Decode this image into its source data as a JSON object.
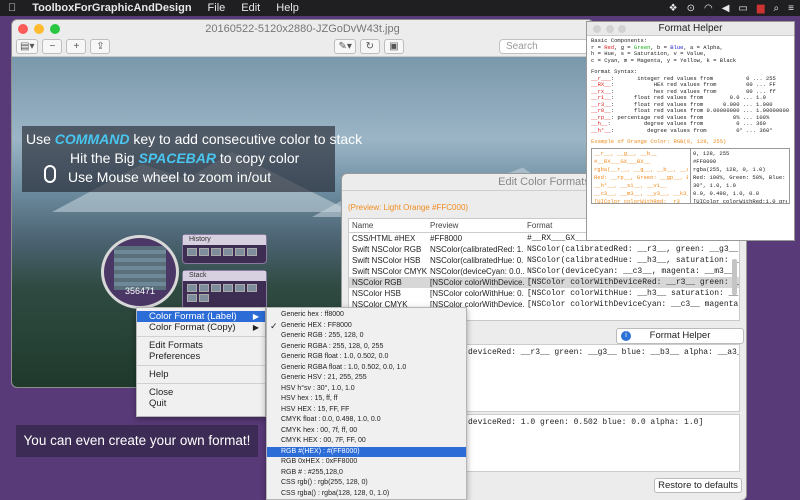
{
  "menubar": {
    "apple": "",
    "app_name": "ToolboxForGraphicAndDesign",
    "items": [
      "File",
      "Edit",
      "Help"
    ],
    "battery": "",
    "flag": "",
    "icons": [
      "dropbox-icon",
      "spotlight-icon",
      "wifi-icon",
      "volume-icon",
      "battery-icon",
      "flag-icon",
      "search-icon",
      "list-icon"
    ]
  },
  "preview_window": {
    "title": "20160522-5120x2880-JZGoDvW43t.jpg",
    "search_placeholder": "Search",
    "hint_line1_pre": "Use ",
    "hint_line1_kw": "COMMAND",
    "hint_line1_post": " key to add consecutive color to stack",
    "hint_line2_pre": "Hit the Big ",
    "hint_line2_kw": "SPACEBAR",
    "hint_line2_post": " to copy color",
    "hint_line3": "Use Mouse wheel to zoom in/out",
    "magnifier_value": "356471",
    "history_label": "History",
    "stack_label": "Stack"
  },
  "tip": "You can even create your own format!",
  "edit_window": {
    "title": "Edit Color Formats",
    "preview_text": "(Preview: Light Orange #FFC000)",
    "columns": [
      "Name",
      "Preview",
      "Format"
    ],
    "rows": [
      {
        "name": "CSS/HTML #HEX",
        "preview": "#FF8000",
        "format": "#__RX___GX___BX_"
      },
      {
        "name": "Swift NSColor RGB",
        "preview": "NSColor(calibratedRed: 1...",
        "format": "NSColor(calibratedRed: __r3__, green: __g3__, blue"
      },
      {
        "name": "Swift NSColor HSB",
        "preview": "NSColor(calibratedHue: 0...",
        "format": "NSColor(calibratedHue: __h3__, saturation: __s3__, bright"
      },
      {
        "name": "Swift NSColor CMYK",
        "preview": "NSColor(deviceCyan: 0.0...",
        "format": "NSColor(deviceCyan: __c3__, magenta: __m3__, yellow: _"
      },
      {
        "name": "NSColor RGB",
        "preview": "[NSColor colorWithDevice...",
        "format": "[NSColor colorWithDeviceRed: __r3__ green: __g3__ blue: _"
      },
      {
        "name": "NSColor HSB",
        "preview": "[NSColor colorWithHue: 0...",
        "format": "[NSColor colorWithHue: __h3__ saturation: __s3__ bright"
      },
      {
        "name": "NSColor CMYK",
        "preview": "[NSColor colorWithDevice...",
        "format": "[NSColor colorWithDeviceCyan: __c3__ magenta: __m3__ ye"
      }
    ],
    "selected_row": 4,
    "format_helper_button": "Format Helper",
    "code1": "deviceRed: __r3__ green: __g3__ blue: __b3__ alpha: __a3__]",
    "code2": "deviceRed: 1.0 green: 0.502 blue: 0.0 alpha: 1.0]",
    "restore_button": "Restore to defaults"
  },
  "format_helper": {
    "title": "Format Helper",
    "basic_header": "Basic Components:",
    "basic_line1_parts": [
      "r = ",
      "Red",
      ", g = ",
      "Green",
      ", b = ",
      "Blue",
      ", a = Alpha,"
    ],
    "basic_line2": "h = Hue, s = Saturation, v = Value,",
    "basic_line3": "c = Cyan, m = Magenta, y = Yellow, k = Black",
    "syntax_header": "Format Syntax:",
    "syntax_lines": [
      {
        "tag": "__r___",
        "desc": ":       integer red values from          0 ... 255"
      },
      {
        "tag": "__RX__",
        "desc": ":            HEX red values from         00 ... FF"
      },
      {
        "tag": "__rx__",
        "desc": ":            hex red values from         00 ... ff"
      },
      {
        "tag": "__r1__",
        "desc": ":      float red values from        0.0 ... 1.0"
      },
      {
        "tag": "__r3__",
        "desc": ":      float red values from      0.000 ... 1.000"
      },
      {
        "tag": "__r8__",
        "desc": ":      float red values from 0.00000000 ... 1.00000000"
      },
      {
        "tag": "__rp__",
        "desc": ": percentage red values from         0% ... 100%"
      },
      {
        "tag": "__h__",
        "desc": ":          degree values from          0 ... 360"
      },
      {
        "tag": "__h°__",
        "desc": ":          degree values from         0° ... 360°"
      }
    ],
    "example_header": "Example of Orange Color: RGB(0, 128, 255)",
    "example_left": [
      "__r__, __g__, __b__",
      "#__RX___GX___BX__",
      "rgba(__r__, __g__, __b__, __a1__)",
      "Red: __rp__, Green: __gp__, Blue: __bp__",
      "__h°__, __s1__, __v1__",
      "__c3__, __m3__, __y3__, __k3__",
      "[UIColor colorWithRed:__r3__ green:__g3__ blue:__b3__ alpha:__a1__]"
    ],
    "example_right": [
      "0, 128, 255",
      "#FF8000",
      "rgba(255, 128, 0, 1.0)",
      "Red: 100%, Green: 50%, Blue: 0%",
      "30°, 1.0, 1.0",
      "0.0, 0.498, 1.0, 0.0",
      "[UIColor colorWithRed:1.0 green:0.502 blue:0.0 alpha:1.0]"
    ]
  },
  "context_menu": {
    "items": [
      {
        "label": "Color Format (Label)",
        "arrow": "▶",
        "highlight": true
      },
      {
        "label": "Color Format (Copy)",
        "arrow": "▶",
        "highlight": false
      },
      {
        "sep": true
      },
      {
        "label": "Edit Formats"
      },
      {
        "label": "Preferences"
      },
      {
        "sep": true
      },
      {
        "label": "Help"
      },
      {
        "sep": true
      },
      {
        "label": "Close"
      },
      {
        "label": "Quit"
      }
    ]
  },
  "submenu": {
    "items": [
      {
        "label": "Generic hex : ff8000"
      },
      {
        "label": "Generic HEX : FF8000",
        "checked": true
      },
      {
        "label": "Generic RGB : 255, 128, 0"
      },
      {
        "label": "Generic RGBA : 255, 128, 0, 255"
      },
      {
        "label": "Generic RGB float : 1.0, 0.502, 0.0"
      },
      {
        "label": "Generic RGBA float : 1.0, 0.502, 0.0, 1.0"
      },
      {
        "label": "Generic HSV : 21, 255, 255"
      },
      {
        "label": "HSV h°sv : 30°, 1.0, 1.0"
      },
      {
        "label": "HSV hex : 15, ff, ff"
      },
      {
        "label": "HSV HEX : 15, FF, FF"
      },
      {
        "label": "CMYK float : 0.0, 0.498, 1.0, 0.0"
      },
      {
        "label": "CMYK hex : 00, 7f, ff, 00"
      },
      {
        "label": "CMYK HEX : 00, 7F, FF, 00"
      },
      {
        "label": "RGB #(HEX) : #(FF8000)",
        "highlight": true
      },
      {
        "label": "RGB 0xHEX : 0xFF8000"
      },
      {
        "label": "RGB # : #255,128,0"
      },
      {
        "label": "CSS rgb() : rgb(255, 128, 0)"
      },
      {
        "label": "CSS rgba() : rgba(128, 128, 0, 1.0)"
      },
      {
        "label": "CSS/HTML #hex : #ff8000"
      },
      {
        "label": "CSS/HTML #HEX : #FF8000"
      }
    ],
    "checkmark": "✓"
  },
  "colors": {
    "accent": "#2c6cd7",
    "keyword": "#48c6f0",
    "background": "#583a78",
    "orange": "#f08a1c"
  }
}
